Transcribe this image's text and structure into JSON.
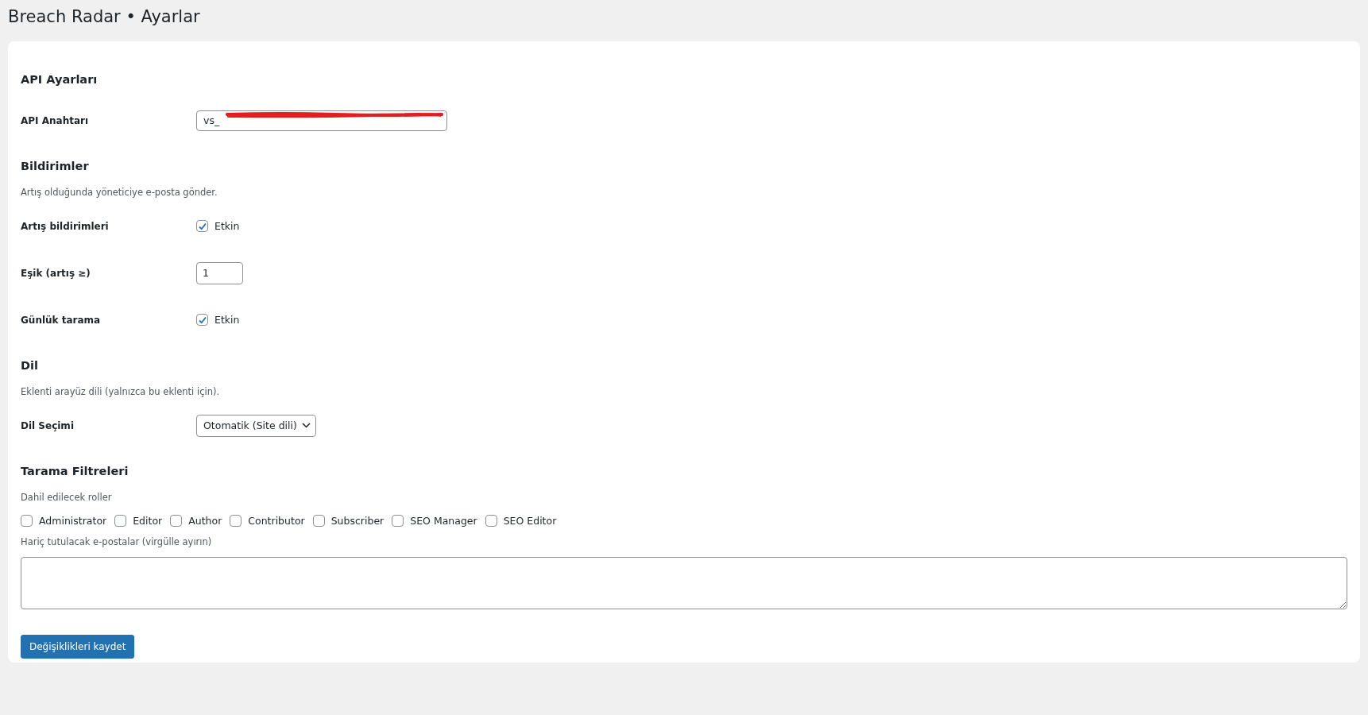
{
  "page_title": "Breach Radar • Ayarlar",
  "sections": [
    {
      "heading": "API Ayarları",
      "fields": [
        {
          "kind": "text",
          "label": "API Anahtarı",
          "value": "vs_",
          "redacted": true
        }
      ]
    },
    {
      "heading": "Bildirimler",
      "description": "Artış olduğunda yöneticiye e-posta gönder.",
      "fields": [
        {
          "kind": "checkbox",
          "label": "Artış bildirimleri",
          "option": "Etkin",
          "checked": true
        },
        {
          "kind": "number",
          "label": "Eşik (artış ≥)",
          "value": "1"
        },
        {
          "kind": "checkbox",
          "label": "Günlük tarama",
          "option": "Etkin",
          "checked": true
        }
      ]
    },
    {
      "heading": "Dil",
      "description": "Eklenti arayüz dili (yalnızca bu eklenti için).",
      "fields": [
        {
          "kind": "select",
          "label": "Dil Seçimi",
          "value": "Otomatik (Site dili)"
        }
      ]
    }
  ],
  "filters": {
    "heading": "Tarama Filtreleri",
    "roles_label": "Dahil edilecek roller",
    "roles": [
      {
        "label": "Administrator",
        "checked": false
      },
      {
        "label": "Editor",
        "checked": false
      },
      {
        "label": "Author",
        "checked": false
      },
      {
        "label": "Contributor",
        "checked": false
      },
      {
        "label": "Subscriber",
        "checked": false
      },
      {
        "label": "SEO Manager",
        "checked": false
      },
      {
        "label": "SEO Editor",
        "checked": false
      }
    ],
    "exclude_label": "Hariç tutulacak e-postalar (virgülle ayırın)"
  },
  "save_button": "Değişiklikleri kaydet"
}
